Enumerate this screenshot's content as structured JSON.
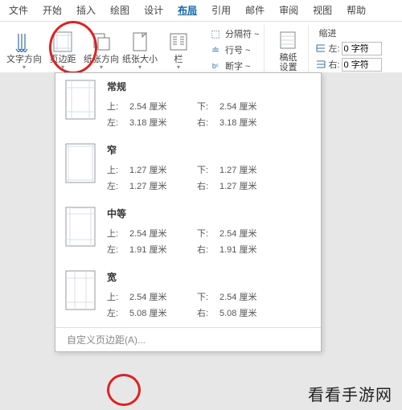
{
  "menubar": {
    "items": [
      "文件",
      "开始",
      "插入",
      "绘图",
      "设计",
      "布局",
      "引用",
      "邮件",
      "审阅",
      "视图",
      "帮助"
    ],
    "active_index": 5
  },
  "ribbon": {
    "text_direction": {
      "label": "文字方向"
    },
    "margins": {
      "label": "页边距"
    },
    "orientation": {
      "label": "纸张方向"
    },
    "paper_size": {
      "label": "纸张大小"
    },
    "columns": {
      "label": "栏"
    },
    "breaks": {
      "label": "分隔符 ~"
    },
    "line_numbers": {
      "label": "行号 ~"
    },
    "hyphenation": {
      "label": "断字 ~"
    },
    "gaozhi": {
      "label": "稿纸",
      "sub": "设置"
    },
    "indent": {
      "heading": "缩进",
      "left": {
        "label": "左:",
        "value": "0 字符"
      },
      "right": {
        "label": "右:",
        "value": "0 字符"
      }
    }
  },
  "margins_dropdown": {
    "presets": [
      {
        "name": "常规",
        "top": "2.54 厘米",
        "bottom": "2.54 厘米",
        "left": "3.18 厘米",
        "right": "3.18 厘米"
      },
      {
        "name": "窄",
        "top": "1.27 厘米",
        "bottom": "1.27 厘米",
        "left": "1.27 厘米",
        "right": "1.27 厘米"
      },
      {
        "name": "中等",
        "top": "2.54 厘米",
        "bottom": "2.54 厘米",
        "left": "1.91 厘米",
        "right": "1.91 厘米"
      },
      {
        "name": "宽",
        "top": "2.54 厘米",
        "bottom": "2.54 厘米",
        "left": "5.08 厘米",
        "right": "5.08 厘米"
      }
    ],
    "labels": {
      "top": "上:",
      "bottom": "下:",
      "left": "左:",
      "right": "右:"
    },
    "custom": "自定义页边距(A)..."
  },
  "watermark": "看看手游网"
}
